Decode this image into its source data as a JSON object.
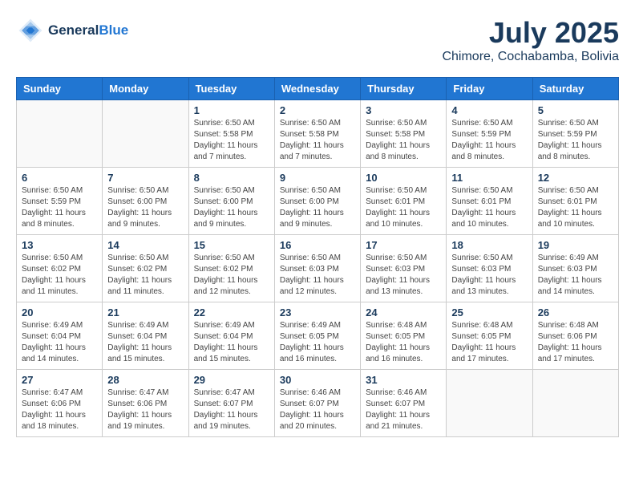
{
  "header": {
    "logo_line1": "General",
    "logo_line2": "Blue",
    "month_title": "July 2025",
    "location": "Chimore, Cochabamba, Bolivia"
  },
  "weekdays": [
    "Sunday",
    "Monday",
    "Tuesday",
    "Wednesday",
    "Thursday",
    "Friday",
    "Saturday"
  ],
  "weeks": [
    [
      {
        "day": "",
        "info": ""
      },
      {
        "day": "",
        "info": ""
      },
      {
        "day": "1",
        "info": "Sunrise: 6:50 AM\nSunset: 5:58 PM\nDaylight: 11 hours and 7 minutes."
      },
      {
        "day": "2",
        "info": "Sunrise: 6:50 AM\nSunset: 5:58 PM\nDaylight: 11 hours and 7 minutes."
      },
      {
        "day": "3",
        "info": "Sunrise: 6:50 AM\nSunset: 5:58 PM\nDaylight: 11 hours and 8 minutes."
      },
      {
        "day": "4",
        "info": "Sunrise: 6:50 AM\nSunset: 5:59 PM\nDaylight: 11 hours and 8 minutes."
      },
      {
        "day": "5",
        "info": "Sunrise: 6:50 AM\nSunset: 5:59 PM\nDaylight: 11 hours and 8 minutes."
      }
    ],
    [
      {
        "day": "6",
        "info": "Sunrise: 6:50 AM\nSunset: 5:59 PM\nDaylight: 11 hours and 8 minutes."
      },
      {
        "day": "7",
        "info": "Sunrise: 6:50 AM\nSunset: 6:00 PM\nDaylight: 11 hours and 9 minutes."
      },
      {
        "day": "8",
        "info": "Sunrise: 6:50 AM\nSunset: 6:00 PM\nDaylight: 11 hours and 9 minutes."
      },
      {
        "day": "9",
        "info": "Sunrise: 6:50 AM\nSunset: 6:00 PM\nDaylight: 11 hours and 9 minutes."
      },
      {
        "day": "10",
        "info": "Sunrise: 6:50 AM\nSunset: 6:01 PM\nDaylight: 11 hours and 10 minutes."
      },
      {
        "day": "11",
        "info": "Sunrise: 6:50 AM\nSunset: 6:01 PM\nDaylight: 11 hours and 10 minutes."
      },
      {
        "day": "12",
        "info": "Sunrise: 6:50 AM\nSunset: 6:01 PM\nDaylight: 11 hours and 10 minutes."
      }
    ],
    [
      {
        "day": "13",
        "info": "Sunrise: 6:50 AM\nSunset: 6:02 PM\nDaylight: 11 hours and 11 minutes."
      },
      {
        "day": "14",
        "info": "Sunrise: 6:50 AM\nSunset: 6:02 PM\nDaylight: 11 hours and 11 minutes."
      },
      {
        "day": "15",
        "info": "Sunrise: 6:50 AM\nSunset: 6:02 PM\nDaylight: 11 hours and 12 minutes."
      },
      {
        "day": "16",
        "info": "Sunrise: 6:50 AM\nSunset: 6:03 PM\nDaylight: 11 hours and 12 minutes."
      },
      {
        "day": "17",
        "info": "Sunrise: 6:50 AM\nSunset: 6:03 PM\nDaylight: 11 hours and 13 minutes."
      },
      {
        "day": "18",
        "info": "Sunrise: 6:50 AM\nSunset: 6:03 PM\nDaylight: 11 hours and 13 minutes."
      },
      {
        "day": "19",
        "info": "Sunrise: 6:49 AM\nSunset: 6:03 PM\nDaylight: 11 hours and 14 minutes."
      }
    ],
    [
      {
        "day": "20",
        "info": "Sunrise: 6:49 AM\nSunset: 6:04 PM\nDaylight: 11 hours and 14 minutes."
      },
      {
        "day": "21",
        "info": "Sunrise: 6:49 AM\nSunset: 6:04 PM\nDaylight: 11 hours and 15 minutes."
      },
      {
        "day": "22",
        "info": "Sunrise: 6:49 AM\nSunset: 6:04 PM\nDaylight: 11 hours and 15 minutes."
      },
      {
        "day": "23",
        "info": "Sunrise: 6:49 AM\nSunset: 6:05 PM\nDaylight: 11 hours and 16 minutes."
      },
      {
        "day": "24",
        "info": "Sunrise: 6:48 AM\nSunset: 6:05 PM\nDaylight: 11 hours and 16 minutes."
      },
      {
        "day": "25",
        "info": "Sunrise: 6:48 AM\nSunset: 6:05 PM\nDaylight: 11 hours and 17 minutes."
      },
      {
        "day": "26",
        "info": "Sunrise: 6:48 AM\nSunset: 6:06 PM\nDaylight: 11 hours and 17 minutes."
      }
    ],
    [
      {
        "day": "27",
        "info": "Sunrise: 6:47 AM\nSunset: 6:06 PM\nDaylight: 11 hours and 18 minutes."
      },
      {
        "day": "28",
        "info": "Sunrise: 6:47 AM\nSunset: 6:06 PM\nDaylight: 11 hours and 19 minutes."
      },
      {
        "day": "29",
        "info": "Sunrise: 6:47 AM\nSunset: 6:07 PM\nDaylight: 11 hours and 19 minutes."
      },
      {
        "day": "30",
        "info": "Sunrise: 6:46 AM\nSunset: 6:07 PM\nDaylight: 11 hours and 20 minutes."
      },
      {
        "day": "31",
        "info": "Sunrise: 6:46 AM\nSunset: 6:07 PM\nDaylight: 11 hours and 21 minutes."
      },
      {
        "day": "",
        "info": ""
      },
      {
        "day": "",
        "info": ""
      }
    ]
  ]
}
